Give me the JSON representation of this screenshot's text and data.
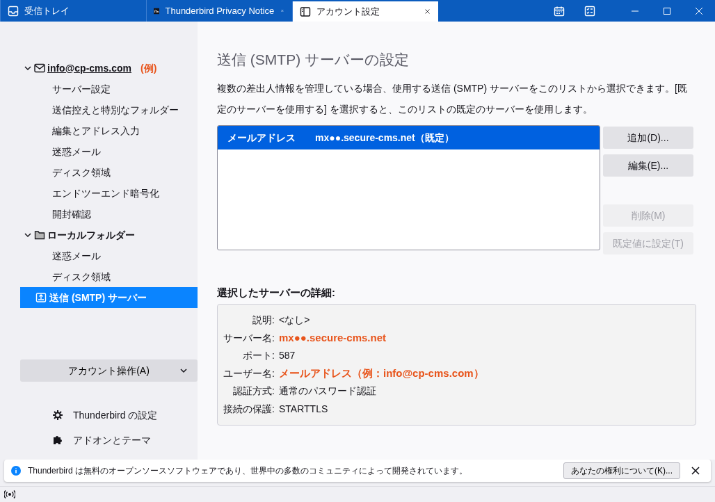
{
  "tabs": [
    {
      "label": "受信トレイ",
      "kind": "inbox",
      "closable": false,
      "selected": false
    },
    {
      "label": "Thunderbird Privacy Notice",
      "kind": "m",
      "closable": true,
      "selected": false
    },
    {
      "label": "アカウント設定",
      "kind": "panel",
      "closable": true,
      "selected": true
    }
  ],
  "sidebar": {
    "accounts": [
      {
        "label": "info@cp-cms.com",
        "note": "(例)",
        "kind": "mail",
        "expanded": true,
        "children": [
          {
            "label": "サーバー設定",
            "selected": false
          },
          {
            "label": "送信控えと特別なフォルダー",
            "selected": false
          },
          {
            "label": "編集とアドレス入力",
            "selected": false
          },
          {
            "label": "迷惑メール",
            "selected": false
          },
          {
            "label": "ディスク領域",
            "selected": false
          },
          {
            "label": "エンドツーエンド暗号化",
            "selected": false
          },
          {
            "label": "開封確認",
            "selected": false
          }
        ]
      },
      {
        "label": "ローカルフォルダー",
        "kind": "folder",
        "expanded": true,
        "children": [
          {
            "label": "迷惑メール",
            "selected": false
          },
          {
            "label": "ディスク領域",
            "selected": false
          }
        ]
      }
    ],
    "smtp_item": {
      "label": "送信 (SMTP) サーバー",
      "selected": true
    },
    "account_actions": "アカウント操作(A)",
    "links": [
      {
        "label": "Thunderbird の設定",
        "kind": "gear"
      },
      {
        "label": "アドオンとテーマ",
        "kind": "puzzle"
      }
    ]
  },
  "main": {
    "title": "送信 (SMTP) サーバーの設定",
    "description": "複数の差出人情報を管理している場合、使用する送信 (SMTP) サーバーをこのリストから選択できます。[既定のサーバーを使用する] を選択すると、このリストの既定のサーバーを使用します。",
    "servers": [
      {
        "name": "メールアドレス",
        "host": "mx●●.secure-cms.net（既定）",
        "selected": true
      }
    ],
    "buttons": [
      {
        "label": "追加(D)...",
        "disabled": false
      },
      {
        "label": "編集(E)...",
        "disabled": false
      },
      {
        "label": "削除(M)",
        "disabled": true
      },
      {
        "label": "既定値に設定(T)",
        "disabled": true
      }
    ],
    "details_title": "選択したサーバーの詳細:",
    "details": [
      {
        "label": "説明:",
        "value": "<なし>",
        "highlight": false
      },
      {
        "label": "サーバー名:",
        "value": "mx●●.secure-cms.net",
        "highlight": true
      },
      {
        "label": "ポート:",
        "value": "587",
        "highlight": false
      },
      {
        "label": "ユーザー名:",
        "value": "メールアドレス（例：info@cp-cms.com）",
        "highlight": true
      },
      {
        "label": "認証方式:",
        "value": "通常のパスワード認証",
        "highlight": false
      },
      {
        "label": "接続の保護:",
        "value": "STARTTLS",
        "highlight": false
      }
    ]
  },
  "notification": {
    "text": "Thunderbird は無料のオープンソースソフトウェアであり、世界中の多数のコミュニティによって開発されています。",
    "button": "あなたの権利について(K)..."
  }
}
